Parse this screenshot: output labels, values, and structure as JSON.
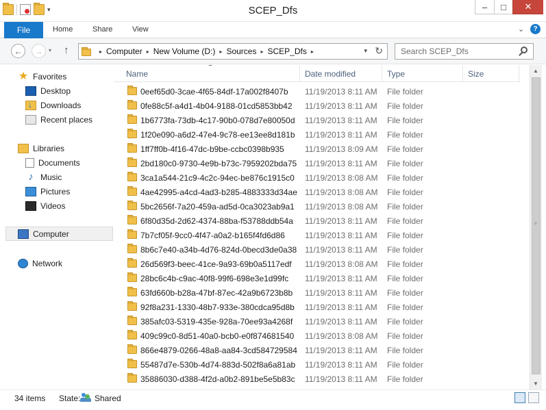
{
  "window": {
    "title": "SCEP_Dfs",
    "minimize_glyph": "–",
    "maximize_glyph": "□",
    "close_glyph": "✕"
  },
  "quick_access": {
    "dropdown_glyph": "▾",
    "icons": [
      "folder-icon",
      "properties-icon",
      "new-folder-icon"
    ]
  },
  "ribbon": {
    "tabs": [
      {
        "label": "File"
      },
      {
        "label": "Home"
      },
      {
        "label": "Share"
      },
      {
        "label": "View"
      }
    ],
    "expand_glyph": "⌄",
    "help_glyph": "?"
  },
  "navigation": {
    "back_glyph": "←",
    "forward_glyph": "→",
    "history_glyph": "▾",
    "up_glyph": "↑"
  },
  "address": {
    "breadcrumb": [
      "Computer",
      "New Volume (D:)",
      "Sources",
      "SCEP_Dfs"
    ],
    "separator": "▸",
    "dropdown_glyph": "▾",
    "refresh_glyph": "↻"
  },
  "search": {
    "placeholder": "Search SCEP_Dfs"
  },
  "nav_pane": {
    "favorites_label": "Favorites",
    "favorites": [
      "Desktop",
      "Downloads",
      "Recent places"
    ],
    "libraries_label": "Libraries",
    "libraries": [
      "Documents",
      "Music",
      "Pictures",
      "Videos"
    ],
    "computer_label": "Computer",
    "network_label": "Network"
  },
  "columns": {
    "name": "Name",
    "date_modified": "Date modified",
    "type": "Type",
    "size": "Size",
    "sort_glyph": "▲"
  },
  "files": [
    {
      "name": "0eef65d0-3cae-4f65-84df-17a002f8407b",
      "date": "11/19/2013 8:11 AM",
      "type": "File folder"
    },
    {
      "name": "0fe88c5f-a4d1-4b04-9188-01cd5853bb42",
      "date": "11/19/2013 8:11 AM",
      "type": "File folder"
    },
    {
      "name": "1b6773fa-73db-4c17-90b0-078d7e80050d",
      "date": "11/19/2013 8:11 AM",
      "type": "File folder"
    },
    {
      "name": "1f20e090-a6d2-47e4-9c78-ee13ee8d181b",
      "date": "11/19/2013 8:11 AM",
      "type": "File folder"
    },
    {
      "name": "1ff7ff0b-4f16-47dc-b9be-ccbc0398b935",
      "date": "11/19/2013 8:09 AM",
      "type": "File folder"
    },
    {
      "name": "2bd180c0-9730-4e9b-b73c-7959202bda75",
      "date": "11/19/2013 8:11 AM",
      "type": "File folder"
    },
    {
      "name": "3ca1a544-21c9-4c2c-94ec-be876c1915c0",
      "date": "11/19/2013 8:08 AM",
      "type": "File folder"
    },
    {
      "name": "4ae42995-a4cd-4ad3-b285-4883333d34ae",
      "date": "11/19/2013 8:08 AM",
      "type": "File folder"
    },
    {
      "name": "5bc2656f-7a20-459a-ad5d-0ca3023ab9a1",
      "date": "11/19/2013 8:08 AM",
      "type": "File folder"
    },
    {
      "name": "6f80d35d-2d62-4374-88ba-f53788ddb54a",
      "date": "11/19/2013 8:11 AM",
      "type": "File folder"
    },
    {
      "name": "7b7cf05f-9cc0-4f47-a0a2-b165f4fd6d86",
      "date": "11/19/2013 8:11 AM",
      "type": "File folder"
    },
    {
      "name": "8b6c7e40-a34b-4d76-824d-0becd3de0a38",
      "date": "11/19/2013 8:11 AM",
      "type": "File folder"
    },
    {
      "name": "26d569f3-beec-41ce-9a93-69b0a5117edf",
      "date": "11/19/2013 8:08 AM",
      "type": "File folder"
    },
    {
      "name": "28bc6c4b-c9ac-40f8-99f6-698e3e1d99fc",
      "date": "11/19/2013 8:11 AM",
      "type": "File folder"
    },
    {
      "name": "63fd660b-b28a-47bf-87ec-42a9b6723b8b",
      "date": "11/19/2013 8:11 AM",
      "type": "File folder"
    },
    {
      "name": "92f8a231-1330-48b7-933e-380cdca95d8b",
      "date": "11/19/2013 8:11 AM",
      "type": "File folder"
    },
    {
      "name": "385afc03-5319-435e-928a-70ee93a4268f",
      "date": "11/19/2013 8:11 AM",
      "type": "File folder"
    },
    {
      "name": "409c99c0-8d51-40a0-bcb0-e0f874681540",
      "date": "11/19/2013 8:08 AM",
      "type": "File folder"
    },
    {
      "name": "866e4879-0266-48a8-aa84-3cd584729584",
      "date": "11/19/2013 8:11 AM",
      "type": "File folder"
    },
    {
      "name": "55487d7e-530b-4d74-883d-502f8a6a81ab",
      "date": "11/19/2013 8:11 AM",
      "type": "File folder"
    },
    {
      "name": "35886030-d388-4f2d-a0b2-891be5e5b83c",
      "date": "11/19/2013 8:11 AM",
      "type": "File folder"
    }
  ],
  "scrollbar": {
    "up_glyph": "▲",
    "down_glyph": "▼",
    "grip_glyph": "≡"
  },
  "status": {
    "item_count": "34 items",
    "state_label": "State:",
    "state_value": "Shared"
  },
  "colors": {
    "file_tab": "#1979ca",
    "close_button": "#c7463b",
    "folder": "#f0c04a",
    "header_text": "#4c607a",
    "secondary_text": "#6d6d6d"
  }
}
